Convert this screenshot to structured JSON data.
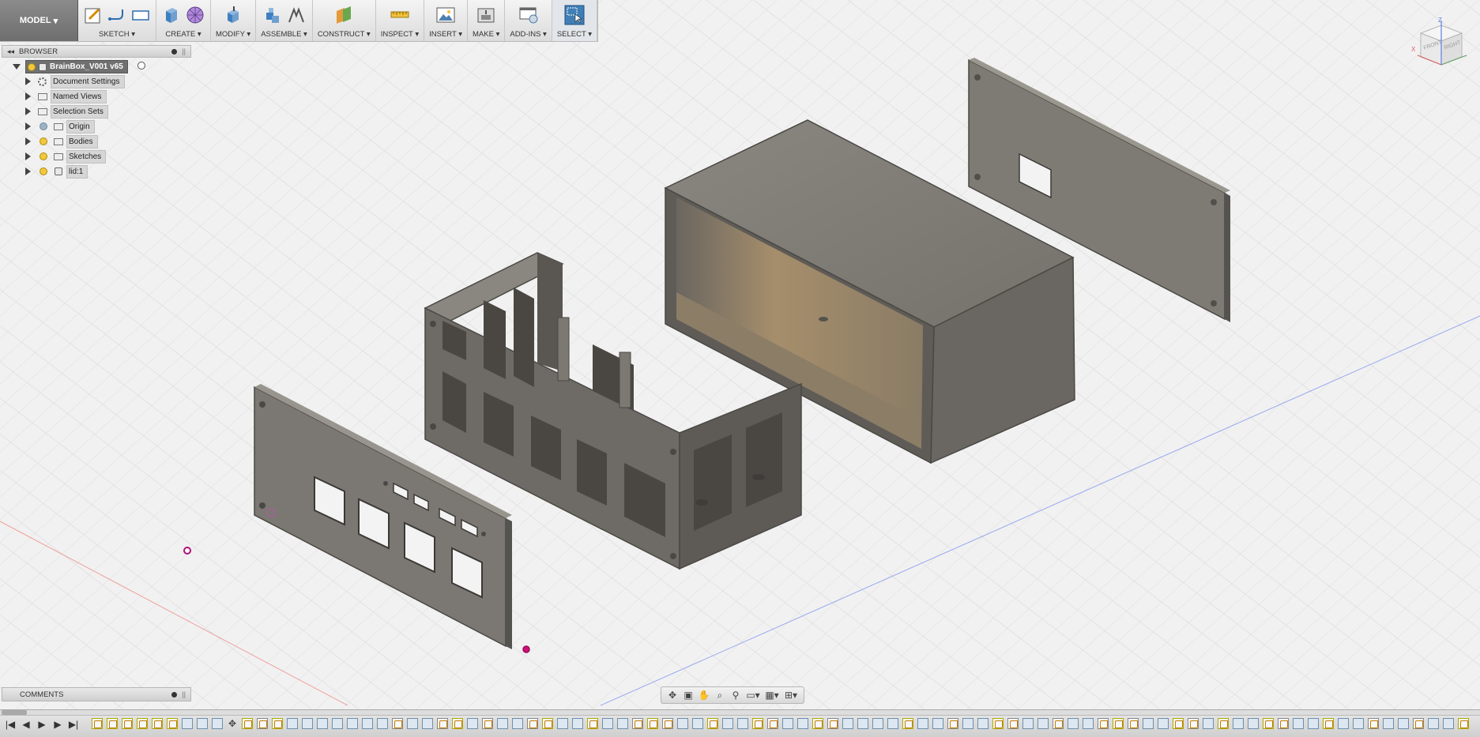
{
  "workspace": {
    "label": "MODEL",
    "arrow": "▾"
  },
  "toolbar": [
    {
      "id": "sketch",
      "label": "SKETCH ▾",
      "icons": [
        "create-sketch-icon",
        "line-icon",
        "rectangle-icon"
      ]
    },
    {
      "id": "create",
      "label": "CREATE ▾",
      "icons": [
        "extrude-box-icon",
        "form-sphere-icon"
      ]
    },
    {
      "id": "modify",
      "label": "MODIFY ▾",
      "icons": [
        "press-pull-icon"
      ]
    },
    {
      "id": "assemble",
      "label": "ASSEMBLE ▾",
      "icons": [
        "new-component-icon",
        "joint-icon"
      ]
    },
    {
      "id": "construct",
      "label": "CONSTRUCT ▾",
      "icons": [
        "offset-plane-icon"
      ]
    },
    {
      "id": "inspect",
      "label": "INSPECT ▾",
      "icons": [
        "measure-icon"
      ]
    },
    {
      "id": "insert",
      "label": "INSERT ▾",
      "icons": [
        "insert-image-icon"
      ]
    },
    {
      "id": "make",
      "label": "MAKE ▾",
      "icons": [
        "3d-print-icon"
      ]
    },
    {
      "id": "addins",
      "label": "ADD-INS ▾",
      "icons": [
        "scripts-icon"
      ]
    },
    {
      "id": "select",
      "label": "SELECT ▾",
      "icons": [
        "select-arrow-icon"
      ]
    }
  ],
  "browser": {
    "title": "BROWSER",
    "root": "BrainBox_V001 v65",
    "items": [
      {
        "label": "Document Settings",
        "icon": "gear-icon",
        "light": false
      },
      {
        "label": "Named Views",
        "icon": "folder-icon",
        "light": false
      },
      {
        "label": "Selection Sets",
        "icon": "folder-icon",
        "light": false
      },
      {
        "label": "Origin",
        "icon": "folder-icon",
        "light": "off"
      },
      {
        "label": "Bodies",
        "icon": "folder-icon",
        "light": "on"
      },
      {
        "label": "Sketches",
        "icon": "folder-icon",
        "light": "on"
      },
      {
        "label": "lid:1",
        "icon": "component-icon",
        "light": "on"
      }
    ]
  },
  "comments": {
    "title": "COMMENTS"
  },
  "viewcube": {
    "front": "FRONT",
    "right": "RIGHT",
    "x": "X",
    "z": "Z"
  },
  "navbar": {
    "icons": [
      "orbit-icon",
      "look-at-icon",
      "pan-icon",
      "zoom-window-icon",
      "fit-icon",
      "display-settings-icon",
      "grid-settings-icon",
      "viewports-icon"
    ]
  },
  "timeline": {
    "controls": [
      "|◀",
      "◀",
      "▶",
      "▶",
      "▶|"
    ],
    "features": "yyyyyyeeemysyeeeeeeeseesyeseesyeeyeesyseeyeeyseeyseeeeyeeseeyseeseesyseeyseyeeyseeyeeseeseeyemysyeeseyeeyeseeyesmyem"
  },
  "colors": {
    "body": "#6f6d68",
    "body_light": "#8a8781",
    "interior": "#a08a6a",
    "grid": "#dcdcdc",
    "accent_select": "#3f7fb5"
  }
}
